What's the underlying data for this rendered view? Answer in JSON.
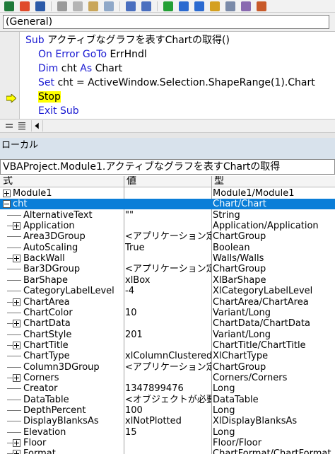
{
  "toolbar": {
    "icons": [
      "excel-icon",
      "insert-module-icon",
      "save-icon",
      "cut-icon",
      "copy-icon",
      "paste-icon",
      "find-icon",
      "undo-icon",
      "redo-icon",
      "run-icon",
      "break-icon",
      "reset-icon",
      "design-mode-icon",
      "project-explorer-icon",
      "properties-icon",
      "object-browser-icon"
    ]
  },
  "object_combo": {
    "value": "(General)"
  },
  "code": {
    "lines": [
      {
        "parts": [
          {
            "t": "Sub",
            "kw": true
          },
          {
            "t": " アクティブなグラフを表すChartの取得()"
          }
        ]
      },
      {
        "parts": [
          {
            "t": "On Error GoTo",
            "kw": true
          },
          {
            "t": " ErrHndl"
          }
        ]
      },
      {
        "parts": [
          {
            "t": "Dim",
            "kw": true
          },
          {
            "t": " cht "
          },
          {
            "t": "As",
            "kw": true
          },
          {
            "t": " Chart"
          }
        ]
      },
      {
        "parts": [
          {
            "t": "Set",
            "kw": true
          },
          {
            "t": " cht = ActiveWindow.Selection.ShapeRange(1).Chart"
          }
        ]
      },
      {
        "parts": [
          {
            "t": "Stop",
            "kw": false,
            "hl": true
          }
        ]
      },
      {
        "parts": [
          {
            "t": "Exit Sub",
            "kw": true
          }
        ]
      }
    ],
    "current_line_index": 4,
    "keyword_color": "#1a1ad2",
    "highlight_color": "#ffff00"
  },
  "locals": {
    "title": "ローカル",
    "context": "VBAProject.Module1.アクティブなグラフを表すChartの取得",
    "headers": {
      "expr": "式",
      "value": "値",
      "type": "型"
    },
    "selected_color": "#0a7ed8",
    "rows": [
      {
        "name": "Module1",
        "value": "",
        "type": "Module1/Module1",
        "level": 0,
        "exp": "plus"
      },
      {
        "name": "cht",
        "value": "",
        "type": "Chart/Chart",
        "level": 0,
        "exp": "minus",
        "selected": true
      },
      {
        "name": "AlternativeText",
        "value": "\"\"",
        "type": "String",
        "level": 1,
        "exp": ""
      },
      {
        "name": "Application",
        "value": "",
        "type": "Application/Application",
        "level": 1,
        "exp": "plus"
      },
      {
        "name": "Area3DGroup",
        "value": "<アプリケーション定義",
        "type": "ChartGroup",
        "level": 1,
        "exp": ""
      },
      {
        "name": "AutoScaling",
        "value": "True",
        "type": "Boolean",
        "level": 1,
        "exp": ""
      },
      {
        "name": "BackWall",
        "value": "",
        "type": "Walls/Walls",
        "level": 1,
        "exp": "plus"
      },
      {
        "name": "Bar3DGroup",
        "value": "<アプリケーション定義",
        "type": "ChartGroup",
        "level": 1,
        "exp": ""
      },
      {
        "name": "BarShape",
        "value": "xlBox",
        "type": "XlBarShape",
        "level": 1,
        "exp": ""
      },
      {
        "name": "CategoryLabelLevel",
        "value": "-4",
        "type": "XlCategoryLabelLevel",
        "level": 1,
        "exp": ""
      },
      {
        "name": "ChartArea",
        "value": "",
        "type": "ChartArea/ChartArea",
        "level": 1,
        "exp": "plus"
      },
      {
        "name": "ChartColor",
        "value": "10",
        "type": "Variant/Long",
        "level": 1,
        "exp": ""
      },
      {
        "name": "ChartData",
        "value": "",
        "type": "ChartData/ChartData",
        "level": 1,
        "exp": "plus"
      },
      {
        "name": "ChartStyle",
        "value": "201",
        "type": "Variant/Long",
        "level": 1,
        "exp": ""
      },
      {
        "name": "ChartTitle",
        "value": "",
        "type": "ChartTitle/ChartTitle",
        "level": 1,
        "exp": "plus"
      },
      {
        "name": "ChartType",
        "value": "xlColumnClustered",
        "type": "XlChartType",
        "level": 1,
        "exp": ""
      },
      {
        "name": "Column3DGroup",
        "value": "<アプリケーション定義",
        "type": "ChartGroup",
        "level": 1,
        "exp": ""
      },
      {
        "name": "Corners",
        "value": "",
        "type": "Corners/Corners",
        "level": 1,
        "exp": "plus"
      },
      {
        "name": "Creator",
        "value": "1347899476",
        "type": "Long",
        "level": 1,
        "exp": ""
      },
      {
        "name": "DataTable",
        "value": "<オブジェクトが必要です",
        "type": "DataTable",
        "level": 1,
        "exp": ""
      },
      {
        "name": "DepthPercent",
        "value": "100",
        "type": "Long",
        "level": 1,
        "exp": ""
      },
      {
        "name": "DisplayBlanksAs",
        "value": "xlNotPlotted",
        "type": "XlDisplayBlanksAs",
        "level": 1,
        "exp": ""
      },
      {
        "name": "Elevation",
        "value": "15",
        "type": "Long",
        "level": 1,
        "exp": ""
      },
      {
        "name": "Floor",
        "value": "",
        "type": "Floor/Floor",
        "level": 1,
        "exp": "plus"
      },
      {
        "name": "Format",
        "value": "",
        "type": "ChartFormat/ChartFormat",
        "level": 1,
        "exp": "plus"
      }
    ]
  }
}
